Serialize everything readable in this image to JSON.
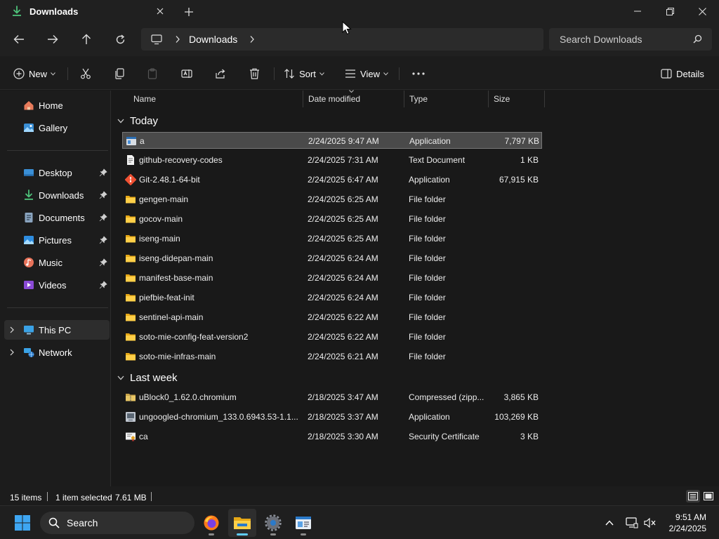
{
  "window": {
    "tab_title": "Downloads"
  },
  "address": {
    "crumbs": [
      "Downloads"
    ],
    "search_placeholder": "Search Downloads"
  },
  "command_bar": {
    "new_label": "New",
    "sort_label": "Sort",
    "view_label": "View",
    "details_label": "Details"
  },
  "sidebar": {
    "quick": [
      {
        "label": "Home",
        "icon": "home-icon"
      },
      {
        "label": "Gallery",
        "icon": "gallery-icon"
      }
    ],
    "pinned": [
      {
        "label": "Desktop",
        "icon": "desktop-icon"
      },
      {
        "label": "Downloads",
        "icon": "downloads-icon"
      },
      {
        "label": "Documents",
        "icon": "documents-icon"
      },
      {
        "label": "Pictures",
        "icon": "pictures-icon"
      },
      {
        "label": "Music",
        "icon": "music-icon"
      },
      {
        "label": "Videos",
        "icon": "videos-icon"
      }
    ],
    "tree": [
      {
        "label": "This PC",
        "icon": "this-pc-icon",
        "selected": true
      },
      {
        "label": "Network",
        "icon": "network-icon"
      }
    ]
  },
  "columns": {
    "name": "Name",
    "date": "Date modified",
    "type": "Type",
    "size": "Size"
  },
  "groups": [
    {
      "label": "Today",
      "files": [
        {
          "name": "a",
          "date": "2/24/2025 9:47 AM",
          "type": "Application",
          "size": "7,797 KB",
          "icon": "app-icon",
          "selected": true
        },
        {
          "name": "github-recovery-codes",
          "date": "2/24/2025 7:31 AM",
          "type": "Text Document",
          "size": "1 KB",
          "icon": "text-file-icon"
        },
        {
          "name": "Git-2.48.1-64-bit",
          "date": "2/24/2025 6:47 AM",
          "type": "Application",
          "size": "67,915 KB",
          "icon": "git-installer-icon"
        },
        {
          "name": "gengen-main",
          "date": "2/24/2025 6:25 AM",
          "type": "File folder",
          "size": "",
          "icon": "folder-icon"
        },
        {
          "name": "gocov-main",
          "date": "2/24/2025 6:25 AM",
          "type": "File folder",
          "size": "",
          "icon": "folder-icon"
        },
        {
          "name": "iseng-main",
          "date": "2/24/2025 6:25 AM",
          "type": "File folder",
          "size": "",
          "icon": "folder-icon"
        },
        {
          "name": "iseng-didepan-main",
          "date": "2/24/2025 6:24 AM",
          "type": "File folder",
          "size": "",
          "icon": "folder-icon"
        },
        {
          "name": "manifest-base-main",
          "date": "2/24/2025 6:24 AM",
          "type": "File folder",
          "size": "",
          "icon": "folder-icon"
        },
        {
          "name": "piefbie-feat-init",
          "date": "2/24/2025 6:24 AM",
          "type": "File folder",
          "size": "",
          "icon": "folder-icon"
        },
        {
          "name": "sentinel-api-main",
          "date": "2/24/2025 6:22 AM",
          "type": "File folder",
          "size": "",
          "icon": "folder-icon"
        },
        {
          "name": "soto-mie-config-feat-version2",
          "date": "2/24/2025 6:22 AM",
          "type": "File folder",
          "size": "",
          "icon": "folder-icon"
        },
        {
          "name": "soto-mie-infras-main",
          "date": "2/24/2025 6:21 AM",
          "type": "File folder",
          "size": "",
          "icon": "folder-icon"
        }
      ]
    },
    {
      "label": "Last week",
      "files": [
        {
          "name": "uBlock0_1.62.0.chromium",
          "date": "2/18/2025 3:47 AM",
          "type": "Compressed (zipp...",
          "size": "3,865 KB",
          "icon": "zip-icon"
        },
        {
          "name": "ungoogled-chromium_133.0.6943.53-1.1...",
          "date": "2/18/2025 3:37 AM",
          "type": "Application",
          "size": "103,269 KB",
          "icon": "installer-icon"
        },
        {
          "name": "ca",
          "date": "2/18/2025 3:30 AM",
          "type": "Security Certificate",
          "size": "3 KB",
          "icon": "certificate-icon"
        }
      ]
    }
  ],
  "status": {
    "count": "15 items",
    "selection": "1 item selected",
    "size": "7.61 MB"
  },
  "taskbar": {
    "search_label": "Search",
    "time": "9:51 AM",
    "date": "2/24/2025"
  },
  "colors": {
    "accent": "#60cdff",
    "folder": "#f4c542",
    "background": "#191919"
  }
}
